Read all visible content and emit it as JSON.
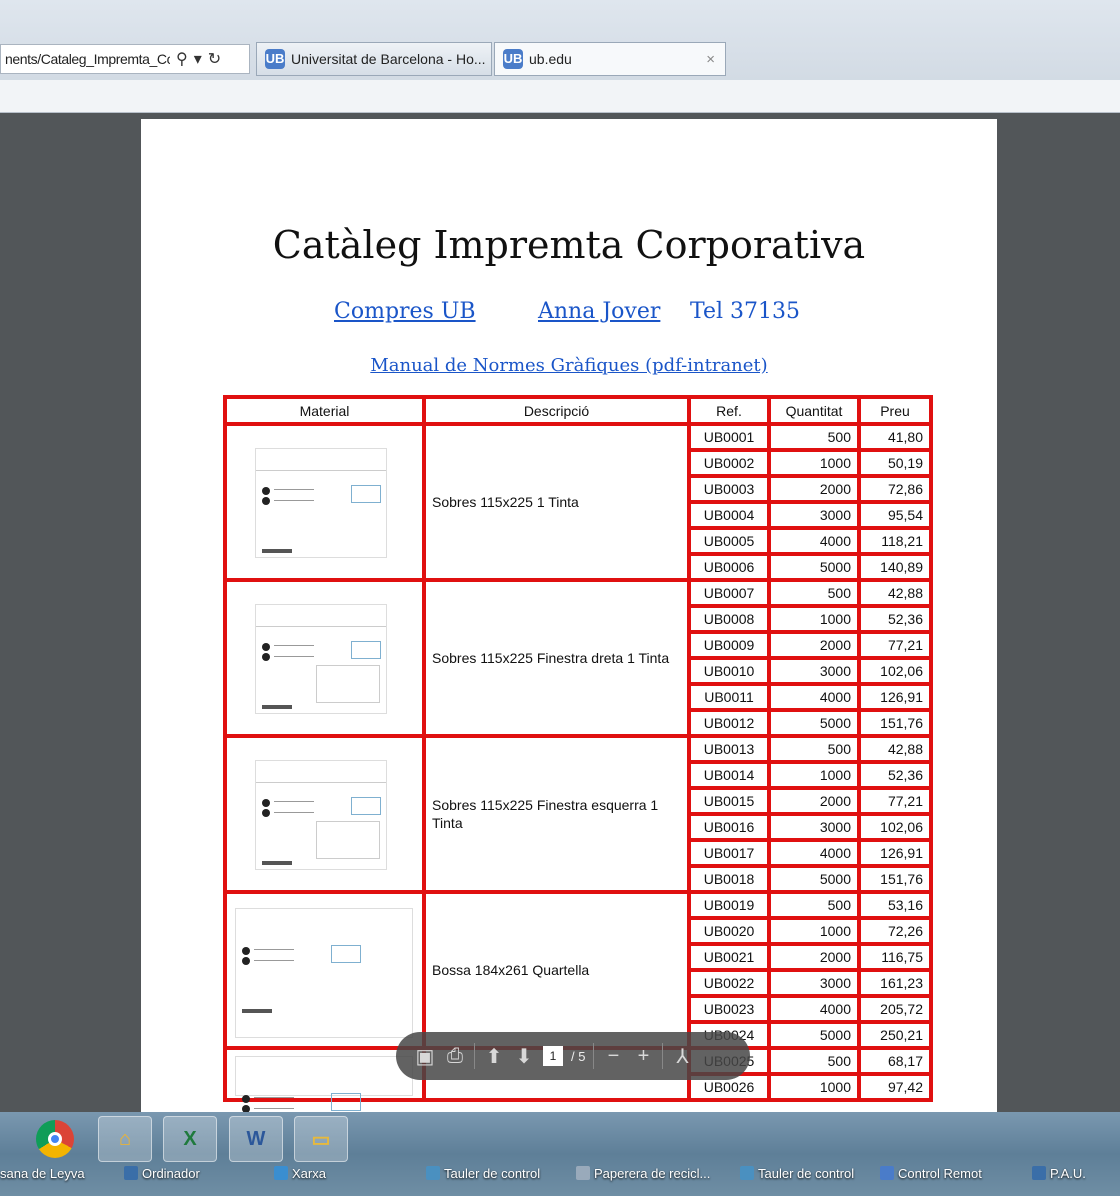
{
  "browser": {
    "url": "nents/Cataleg_Impremta_Cc",
    "tabs": [
      {
        "label": "Universitat de Barcelona - Ho...",
        "favicon": "UB"
      },
      {
        "label": "ub.edu",
        "favicon": "UB"
      }
    ],
    "close_glyph": "×"
  },
  "document": {
    "title": "Catàleg Impremta Corporativa",
    "link_compres": "Compres UB",
    "link_anna": "Anna Jover",
    "tel": "Tel 37135",
    "manual_link": "Manual de Normes Gràfiques (pdf-intranet)",
    "headers": {
      "material": "Material",
      "descripcio": "Descripció",
      "ref": "Ref.",
      "quantitat": "Quantitat",
      "preu": "Preu"
    },
    "groups": [
      {
        "description": "Sobres 115x225   1 Tinta",
        "rows": [
          {
            "ref": "UB0001",
            "qty": "500",
            "price": "41,80"
          },
          {
            "ref": "UB0002",
            "qty": "1000",
            "price": "50,19"
          },
          {
            "ref": "UB0003",
            "qty": "2000",
            "price": "72,86"
          },
          {
            "ref": "UB0004",
            "qty": "3000",
            "price": "95,54"
          },
          {
            "ref": "UB0005",
            "qty": "4000",
            "price": "118,21"
          },
          {
            "ref": "UB0006",
            "qty": "5000",
            "price": "140,89"
          }
        ]
      },
      {
        "description": "Sobres 115x225   Finestra dreta 1 Tinta",
        "rows": [
          {
            "ref": "UB0007",
            "qty": "500",
            "price": "42,88"
          },
          {
            "ref": "UB0008",
            "qty": "1000",
            "price": "52,36"
          },
          {
            "ref": "UB0009",
            "qty": "2000",
            "price": "77,21"
          },
          {
            "ref": "UB0010",
            "qty": "3000",
            "price": "102,06"
          },
          {
            "ref": "UB0011",
            "qty": "4000",
            "price": "126,91"
          },
          {
            "ref": "UB0012",
            "qty": "5000",
            "price": "151,76"
          }
        ]
      },
      {
        "description": "Sobres 115x225   Finestra esquerra  1 Tinta",
        "rows": [
          {
            "ref": "UB0013",
            "qty": "500",
            "price": "42,88"
          },
          {
            "ref": "UB0014",
            "qty": "1000",
            "price": "52,36"
          },
          {
            "ref": "UB0015",
            "qty": "2000",
            "price": "77,21"
          },
          {
            "ref": "UB0016",
            "qty": "3000",
            "price": "102,06"
          },
          {
            "ref": "UB0017",
            "qty": "4000",
            "price": "126,91"
          },
          {
            "ref": "UB0018",
            "qty": "5000",
            "price": "151,76"
          }
        ]
      },
      {
        "description": "Bossa 184x261 Quartella",
        "rows": [
          {
            "ref": "UB0019",
            "qty": "500",
            "price": "53,16"
          },
          {
            "ref": "UB0020",
            "qty": "1000",
            "price": "72,26"
          },
          {
            "ref": "UB0021",
            "qty": "2000",
            "price": "116,75"
          },
          {
            "ref": "UB0022",
            "qty": "3000",
            "price": "161,23"
          },
          {
            "ref": "UB0023",
            "qty": "4000",
            "price": "205,72"
          },
          {
            "ref": "UB0024",
            "qty": "5000",
            "price": "250,21"
          }
        ]
      },
      {
        "description": "",
        "rows": [
          {
            "ref": "UB0025",
            "qty": "500",
            "price": "68,17"
          },
          {
            "ref": "UB0026",
            "qty": "1000",
            "price": "97,42"
          }
        ]
      }
    ]
  },
  "pdf_toolbar": {
    "page_current": "1",
    "page_total": "/ 5"
  },
  "taskbar": {
    "apps": [
      {
        "name": "chrome-icon"
      },
      {
        "name": "explorer-icon",
        "glyph": "⌂"
      },
      {
        "name": "excel-icon",
        "glyph": "X"
      },
      {
        "name": "word-icon",
        "glyph": "W"
      },
      {
        "name": "folder-icon",
        "glyph": "▭"
      }
    ],
    "desktop_items": [
      "sana de Leyva",
      "Ordinador",
      "Xarxa",
      "Tauler de control",
      "Paperera de recicl...",
      "Tauler de control",
      "Control Remot",
      "P.A.U."
    ]
  }
}
